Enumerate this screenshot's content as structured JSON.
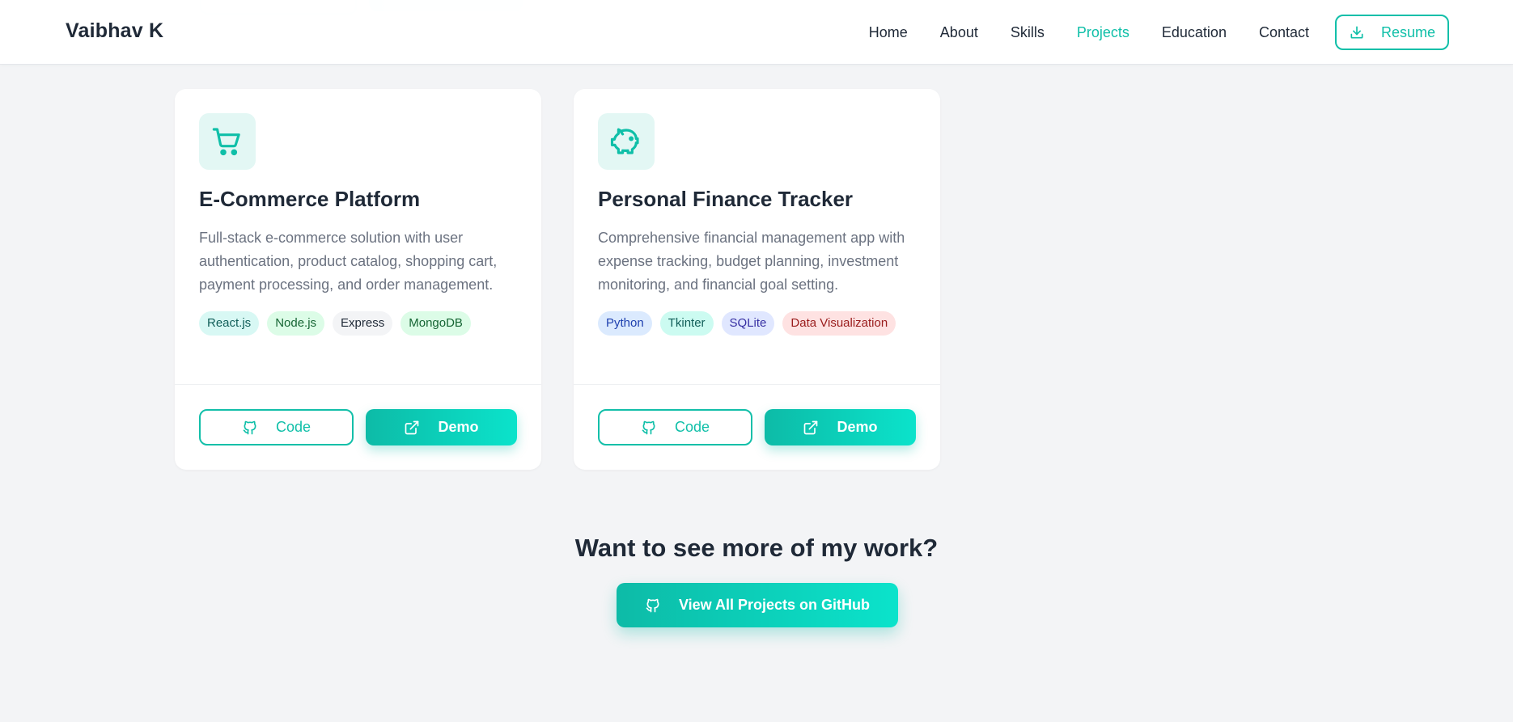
{
  "header": {
    "logo": "Vaibhav K",
    "nav": [
      "Home",
      "About",
      "Skills",
      "Projects",
      "Education",
      "Contact"
    ],
    "active_nav": "Projects",
    "resume_label": "Resume"
  },
  "projects": [
    {
      "icon": "shopping-cart-icon",
      "title": "E-Commerce Platform",
      "description": "Full-stack e-commerce solution with user authentication, product catalog, shopping cart, payment processing, and order management.",
      "tags": [
        "React.js",
        "Node.js",
        "Express",
        "MongoDB"
      ],
      "code_label": "Code",
      "demo_label": "Demo"
    },
    {
      "icon": "piggy-bank-icon",
      "title": "Personal Finance Tracker",
      "description": "Comprehensive financial management app with expense tracking, budget planning, investment monitoring, and financial goal setting.",
      "tags": [
        "Python",
        "Tkinter",
        "SQLite",
        "Data Visualization"
      ],
      "code_label": "Code",
      "demo_label": "Demo"
    }
  ],
  "cta": {
    "title": "Want to see more of my work?",
    "button_label": "View All Projects on GitHub"
  },
  "colors": {
    "accent": "#0fbfa8",
    "accent_gradient_end": "#0be3cb",
    "page_bg": "#f3f4f6",
    "card_bg": "#ffffff",
    "text": "#1f2937",
    "muted": "#6b7280",
    "tag_styles": {
      "React.js": {
        "bg": "#d8f8f4",
        "fg": "#115e59"
      },
      "Node.js": {
        "bg": "#dcfce7",
        "fg": "#166534"
      },
      "Express": {
        "bg": "#f3f4f6",
        "fg": "#1f2937"
      },
      "MongoDB": {
        "bg": "#dcfce7",
        "fg": "#166534"
      },
      "Python": {
        "bg": "#dbeafe",
        "fg": "#1e40af"
      },
      "Tkinter": {
        "bg": "#ccfbf1",
        "fg": "#115e59"
      },
      "SQLite": {
        "bg": "#e0e7ff",
        "fg": "#3730a3"
      },
      "Data Visualization": {
        "bg": "#fee2e2",
        "fg": "#991b1b"
      }
    }
  }
}
